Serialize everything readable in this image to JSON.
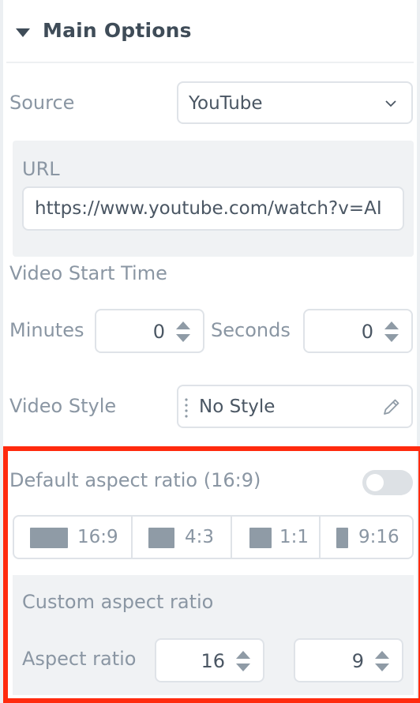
{
  "section": {
    "title": "Main Options"
  },
  "source": {
    "label": "Source",
    "selected": "YouTube"
  },
  "url": {
    "label": "URL",
    "value": "https://www.youtube.com/watch?v=AI"
  },
  "start_time": {
    "label": "Video Start Time",
    "minutes_label": "Minutes",
    "minutes_value": "0",
    "seconds_label": "Seconds",
    "seconds_value": "0"
  },
  "video_style": {
    "label": "Video Style",
    "value": "No Style"
  },
  "aspect": {
    "default_label": "Default aspect ratio (16:9)",
    "toggle_on": false,
    "options": [
      "16:9",
      "4:3",
      "1:1",
      "9:16"
    ],
    "custom_label": "Custom aspect ratio",
    "ratio_label": "Aspect ratio",
    "ratio_w": "16",
    "ratio_h": "9"
  },
  "colors": {
    "highlight": "#ff2a0e",
    "label": "#8a96a3",
    "heading": "#3f4c58",
    "border": "#dfe3e8",
    "panel_bg": "#f0f2f4"
  },
  "icons": {
    "caret": "caret-down-icon",
    "chevron": "chevron-down-icon",
    "spinner": "spinner-arrows-icon",
    "drag": "drag-handle-icon",
    "edit": "pencil-icon"
  }
}
